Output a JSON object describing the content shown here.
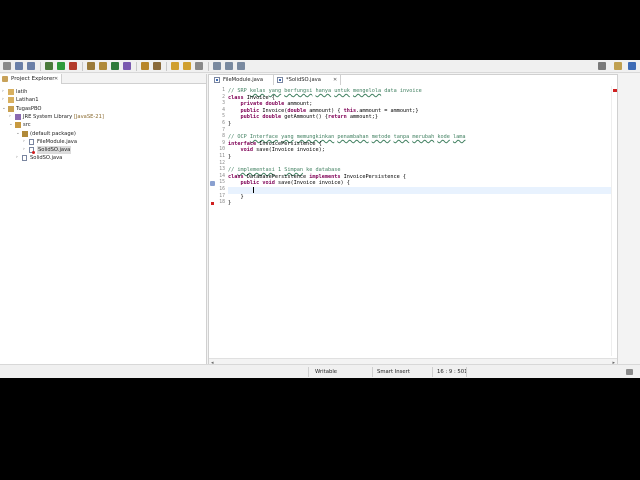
{
  "explorer": {
    "tab_label": "Project Explorer",
    "tree": [
      {
        "label": "latih",
        "level": 0,
        "arrow": "›",
        "icon": "project-folder-icon"
      },
      {
        "label": "Latihan1",
        "level": 0,
        "arrow": "›",
        "icon": "project-folder-icon"
      },
      {
        "label": "TugasPBO",
        "level": 0,
        "arrow": "⌄",
        "icon": "java-project-icon"
      },
      {
        "label": "JRE System Library",
        "decoration": "[JavaSE-21]",
        "level": 1,
        "arrow": "›",
        "icon": "library-icon"
      },
      {
        "label": "src",
        "level": 1,
        "arrow": "⌄",
        "icon": "source-folder-icon"
      },
      {
        "label": "(default package)",
        "level": 2,
        "arrow": "⌄",
        "icon": "package-icon"
      },
      {
        "label": "FileModule.java",
        "level": 3,
        "arrow": "›",
        "icon": "java-file-icon"
      },
      {
        "label": "SolidSO.java",
        "level": 3,
        "arrow": "›",
        "icon": "java-file-error-icon",
        "selected": true
      },
      {
        "label": "SolidSO.java",
        "level": 2,
        "arrow": "›",
        "icon": "java-file-icon"
      }
    ]
  },
  "editor": {
    "tabs": [
      {
        "label": "FileModule.java",
        "active": false
      },
      {
        "label": "*SolidSO.java",
        "active": true
      }
    ],
    "lines": [
      {
        "n": "1",
        "text": "// SRP kelas yang berfungsi hanya untuk mengelola data invoice"
      },
      {
        "n": "2",
        "text": "class Invoice {"
      },
      {
        "n": "3",
        "text": "    private double ammount;"
      },
      {
        "n": "4",
        "text": "    public Invoice(double ammount) { this.ammount = ammount;}"
      },
      {
        "n": "5",
        "text": "    public double getAmmount() {return ammount;}"
      },
      {
        "n": "6",
        "text": "}"
      },
      {
        "n": "7",
        "text": ""
      },
      {
        "n": "8",
        "text": "// OCP Interface yang memungkinkan penambahan metode tanpa merubah kode lama"
      },
      {
        "n": "9",
        "text": "interface InvoicePersistence {"
      },
      {
        "n": "10",
        "text": "    void save(Invoice invoice);"
      },
      {
        "n": "11",
        "text": "}"
      },
      {
        "n": "12",
        "text": ""
      },
      {
        "n": "13",
        "text": "// implementasi 1 Simpan ke database"
      },
      {
        "n": "14",
        "text": "class DatabasePersistence implements InvoicePersistence {"
      },
      {
        "n": "15",
        "text": "    public void save(Invoice invoice) {"
      },
      {
        "n": "16",
        "text": "        "
      },
      {
        "n": "17",
        "text": "    }"
      },
      {
        "n": "18",
        "text": "}"
      }
    ]
  },
  "status": {
    "writable": "Writable",
    "insert_mode": "Smart Insert",
    "position": "16 : 9 : 501"
  },
  "colors": {
    "comment": "#3f7f5f",
    "keyword": "#7f0055",
    "current_line": "#e8f2fe"
  }
}
